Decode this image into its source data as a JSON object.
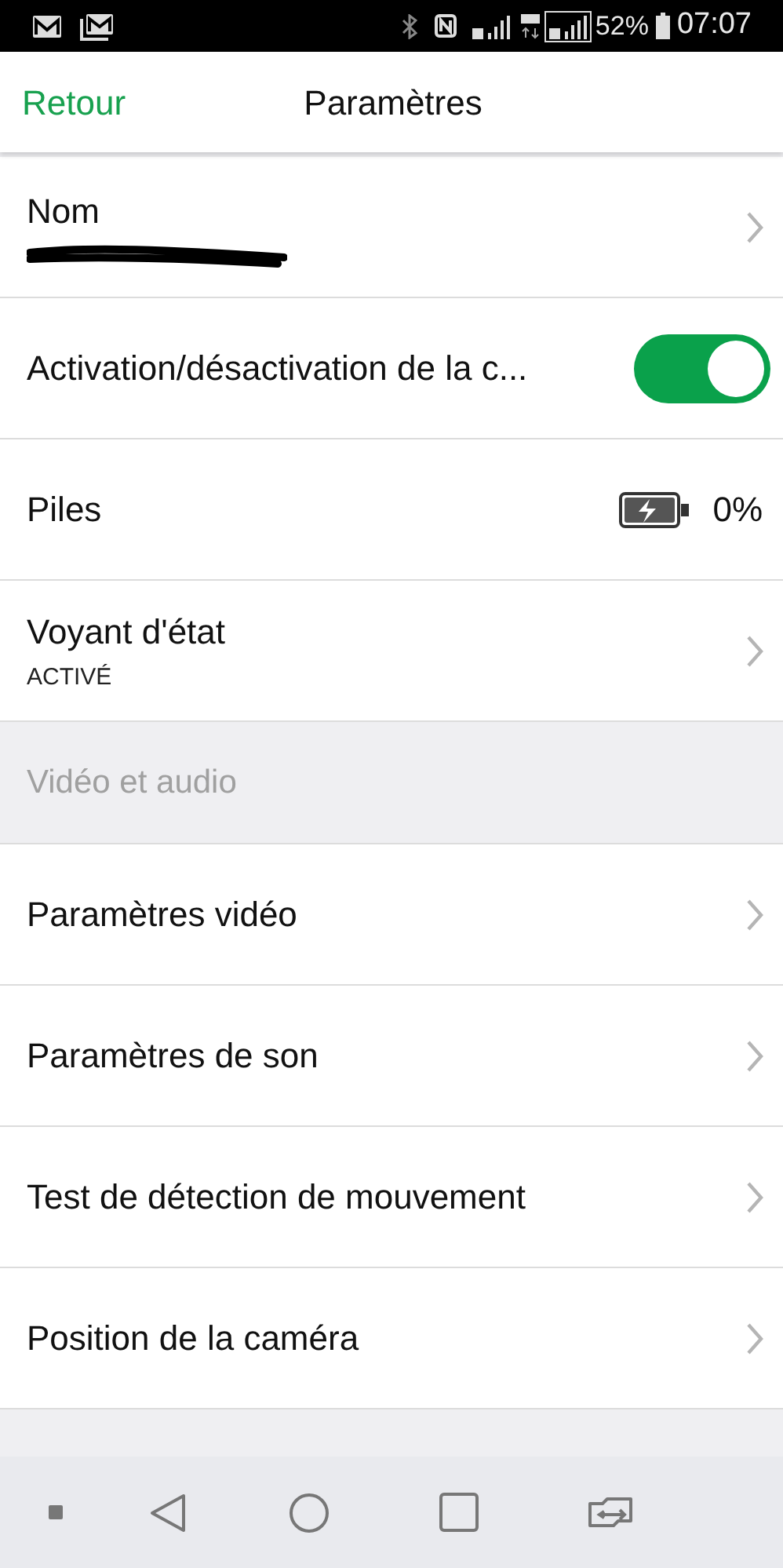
{
  "status_bar": {
    "battery": "52%",
    "time": "07:07"
  },
  "header": {
    "back": "Retour",
    "title": "Paramètres"
  },
  "items": [
    {
      "kind": "nav",
      "label": "Nom",
      "redacted_value": true
    },
    {
      "kind": "toggle",
      "label": "Activation/désactivation de la c...",
      "on": true
    },
    {
      "kind": "battery",
      "label": "Piles",
      "reading": "0%"
    },
    {
      "kind": "nav",
      "label": "Voyant d'état",
      "subtitle": "ACTIVÉ"
    },
    {
      "kind": "section",
      "label": "Vidéo et audio"
    },
    {
      "kind": "nav",
      "label": "Paramètres vidéo"
    },
    {
      "kind": "nav",
      "label": "Paramètres de son"
    },
    {
      "kind": "nav",
      "label": "Test de détection de mouvement"
    },
    {
      "kind": "nav",
      "label": "Position de la caméra"
    }
  ]
}
